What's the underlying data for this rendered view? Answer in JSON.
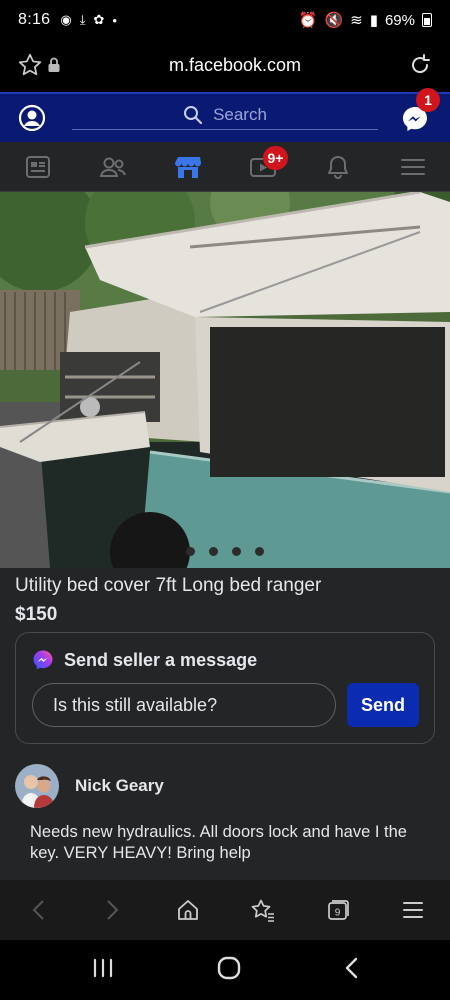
{
  "status_bar": {
    "time": "8:16",
    "battery": "69%"
  },
  "browser": {
    "url": "m.facebook.com"
  },
  "fb_header": {
    "search_placeholder": "Search",
    "messenger_badge": "1"
  },
  "fb_nav": {
    "video_badge": "9+"
  },
  "listing": {
    "title": "Utility bed cover 7ft Long bed ranger",
    "price": "$150",
    "photo_count": 4,
    "message": {
      "header": "Send seller a message",
      "input_value": "Is this still available?",
      "send_label": "Send"
    },
    "seller": {
      "name": "Nick Geary"
    },
    "description": "Needs new hydraulics. All doors lock and have I the key. VERY HEAVY! Bring help"
  },
  "browser_nav": {
    "tabs_count": "9"
  },
  "colors": {
    "fb_header_bg": "#0a1a73",
    "badge_red": "#d0151c",
    "send_button": "#0b2bb0",
    "panel_bg": "#242526"
  }
}
